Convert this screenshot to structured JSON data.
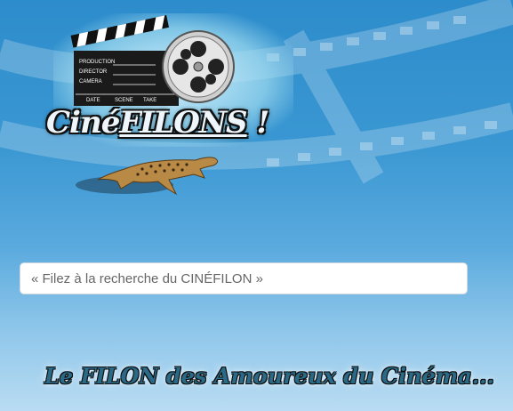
{
  "logo": {
    "part1": "Ciné",
    "part2": "FILONS",
    "part3": " !",
    "clapper": [
      "PRODUCTION",
      "DIRECTOR",
      "CAMERA",
      "DATE",
      "SCENE",
      "TAKE"
    ]
  },
  "search": {
    "placeholder": "« Filez à la recherche du CINÉFILON »"
  },
  "tagline": "Le FILON des Amoureux du Cinéma..."
}
